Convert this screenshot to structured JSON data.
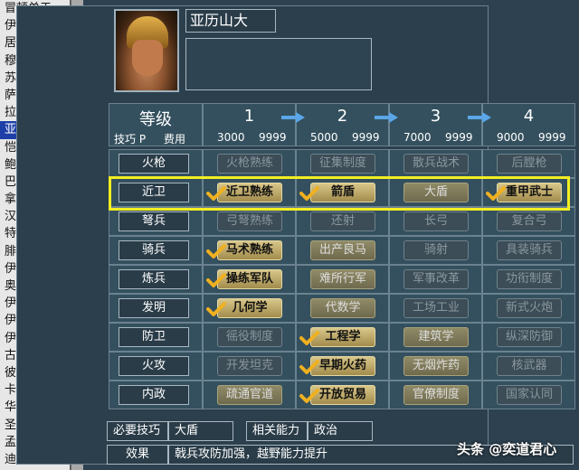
{
  "general_list": [
    "冒顿单于",
    "伊利可汗",
    "居鲁士",
    "穆罕默德",
    "苏莱曼",
    "萨尔贡",
    "拉美西斯",
    "亚历山大",
    "恺撒",
    "鲍德温",
    "巴西尔 II",
    "拿破仑",
    "汉尼拔",
    "特蕾莎",
    "腓特烈",
    "伊丽莎白",
    "奥兰治",
    "伊莎贝拉",
    "伊德里斯",
    "伊斯特万",
    "古斯塔夫",
    "彼得",
    "卡齐米日",
    "华盛顿",
    "圣马丁",
    "孟尼利克",
    "迪雅"
  ],
  "selected_index": 7,
  "general": {
    "name": "亚历山大",
    "bio": ""
  },
  "grid": {
    "level_label": "等级",
    "skill_label": "技巧 P",
    "cost_label": "费用",
    "levels": [
      {
        "num": "1",
        "p": "3000",
        "cost": "9999"
      },
      {
        "num": "2",
        "p": "5000",
        "cost": "9999"
      },
      {
        "num": "3",
        "p": "7000",
        "cost": "9999"
      },
      {
        "num": "4",
        "p": "9000",
        "cost": "9999"
      }
    ]
  },
  "rows": [
    {
      "label": "火枪",
      "skills": [
        {
          "t": "火枪熟练",
          "s": "locked"
        },
        {
          "t": "征集制度",
          "s": "locked"
        },
        {
          "t": "散兵战术",
          "s": "locked"
        },
        {
          "t": "后膛枪",
          "s": "locked"
        }
      ]
    },
    {
      "label": "近卫",
      "skills": [
        {
          "t": "近卫熟练",
          "s": "learned",
          "c": true
        },
        {
          "t": "箭盾",
          "s": "learned",
          "c": true
        },
        {
          "t": "大盾",
          "s": "avail"
        },
        {
          "t": "重甲武士",
          "s": "learned",
          "c": true
        }
      ]
    },
    {
      "label": "弩兵",
      "skills": [
        {
          "t": "弓弩熟练",
          "s": "locked"
        },
        {
          "t": "还射",
          "s": "locked"
        },
        {
          "t": "长弓",
          "s": "locked"
        },
        {
          "t": "复合弓",
          "s": "locked"
        }
      ]
    },
    {
      "label": "骑兵",
      "skills": [
        {
          "t": "马术熟练",
          "s": "learned",
          "c": true
        },
        {
          "t": "出产良马",
          "s": "avail"
        },
        {
          "t": "骑射",
          "s": "locked"
        },
        {
          "t": "具装骑兵",
          "s": "locked"
        }
      ]
    },
    {
      "label": "炼兵",
      "skills": [
        {
          "t": "操练军队",
          "s": "learned",
          "c": true
        },
        {
          "t": "难所行军",
          "s": "avail"
        },
        {
          "t": "军事改革",
          "s": "locked"
        },
        {
          "t": "功衔制度",
          "s": "locked"
        }
      ]
    },
    {
      "label": "发明",
      "skills": [
        {
          "t": "几何学",
          "s": "learned",
          "c": true
        },
        {
          "t": "代数学",
          "s": "avail"
        },
        {
          "t": "工场工业",
          "s": "locked"
        },
        {
          "t": "新式火炮",
          "s": "locked"
        }
      ]
    },
    {
      "label": "防卫",
      "skills": [
        {
          "t": "徭役制度",
          "s": "locked"
        },
        {
          "t": "工程学",
          "s": "learned",
          "c": true
        },
        {
          "t": "建筑学",
          "s": "avail"
        },
        {
          "t": "纵深防御",
          "s": "locked"
        }
      ]
    },
    {
      "label": "火攻",
      "skills": [
        {
          "t": "开发坦克",
          "s": "locked"
        },
        {
          "t": "早期火药",
          "s": "learned",
          "c": true
        },
        {
          "t": "无烟炸药",
          "s": "avail"
        },
        {
          "t": "核武器",
          "s": "locked"
        }
      ]
    },
    {
      "label": "内政",
      "skills": [
        {
          "t": "疏通官道",
          "s": "avail"
        },
        {
          "t": "开放贸易",
          "s": "learned",
          "c": true
        },
        {
          "t": "官僚制度",
          "s": "avail"
        },
        {
          "t": "国家认同",
          "s": "locked"
        }
      ]
    }
  ],
  "footer": {
    "req_label": "必要技巧",
    "req_value": "大盾",
    "rel_label": "相关能力",
    "rel_value": "政治",
    "effect_label": "效果",
    "effect_value": "戟兵攻防加强，越野能力提升"
  },
  "watermark": "头条 @奕道君心",
  "colors": {
    "highlight": "#f2ee22",
    "selected": "#1e3fa8",
    "learned": "#d8c68a"
  }
}
